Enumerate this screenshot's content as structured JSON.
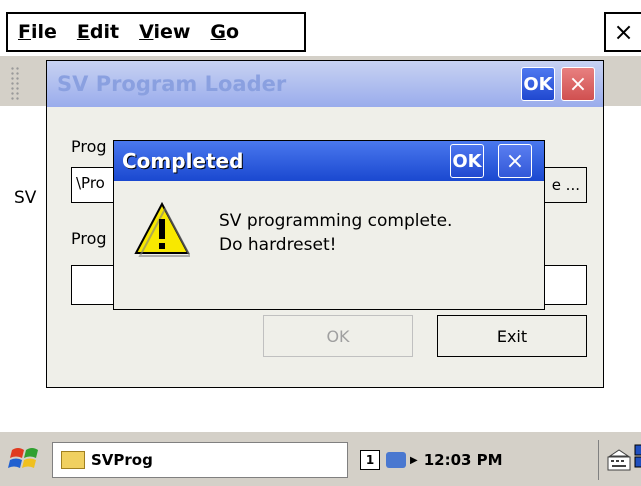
{
  "menu": {
    "items": [
      {
        "label": "File",
        "mn": "F",
        "rest": "ile"
      },
      {
        "label": "Edit",
        "mn": "E",
        "rest": "dit"
      },
      {
        "label": "View",
        "mn": "V",
        "rest": "iew"
      },
      {
        "label": "Go",
        "mn": "G",
        "rest": "o"
      }
    ],
    "close_glyph": "×"
  },
  "background": {
    "partial_label": "SV"
  },
  "loader_dialog": {
    "title": "SV Program Loader",
    "ok_label": "OK",
    "close_glyph": "×",
    "program_label_partial": "Prog",
    "path_value_partial": "\\Pro",
    "browse_label": "e ...",
    "progress_label_partial": "Prog",
    "ok_button": "OK",
    "exit_button": "Exit"
  },
  "message_box": {
    "title": "Completed",
    "ok_label": "OK",
    "close_glyph": "×",
    "line1": "SV programming complete.",
    "line2": "Do hardreset!",
    "icon": "warning-icon"
  },
  "taskbar": {
    "task_label": "SVProg",
    "tray_badge": "1",
    "time": "12:03 PM",
    "icons": [
      "start-icon",
      "folder-icon",
      "network-icon",
      "keyboard-icon",
      "desktop-icon"
    ]
  },
  "colors": {
    "active_title": "#1a48d0",
    "inactive_title": "#9aacec",
    "warning_yellow": "#f8e800"
  }
}
